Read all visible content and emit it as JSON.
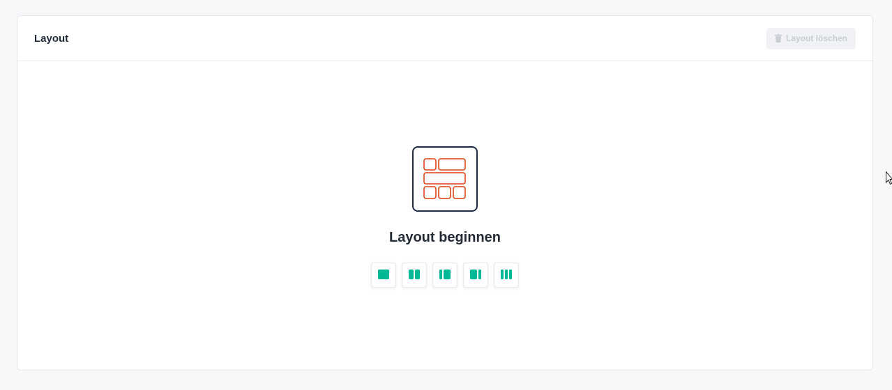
{
  "card": {
    "title": "Layout",
    "delete_button_label": "Layout löschen",
    "delete_button_icon": "trash-icon"
  },
  "empty_state": {
    "icon": "layout-grid-icon",
    "title": "Layout beginnen"
  },
  "layout_options": [
    {
      "name": "single-column-icon"
    },
    {
      "name": "two-column-icon"
    },
    {
      "name": "wide-right-column-icon"
    },
    {
      "name": "wide-left-column-icon"
    },
    {
      "name": "three-column-icon"
    }
  ],
  "colors": {
    "accent": "#00b894",
    "icon_frame": "#1e2a48",
    "icon_cells": "#e4572e",
    "disabled_text": "#c8ccd3"
  }
}
